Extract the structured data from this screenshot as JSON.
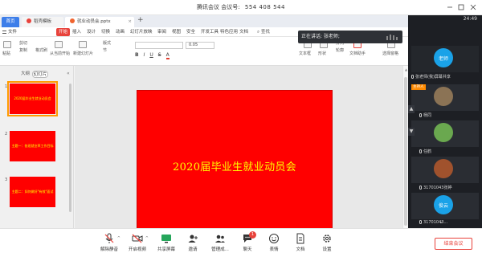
{
  "titlebar": {
    "app_name": "腾讯会议",
    "meeting_label": "会议号:",
    "meeting_id": "554 408 544"
  },
  "wps": {
    "tabs": {
      "home": "首页",
      "template": "稻壳模板",
      "document": "就业动员会.pptx"
    },
    "menu": {
      "file": "文件",
      "items": [
        "开始",
        "插入",
        "设计",
        "切换",
        "动画",
        "幻灯片放映",
        "审阅",
        "视图",
        "安全",
        "开发工具",
        "特色应用",
        "文档"
      ],
      "search": "查找"
    },
    "ribbon": {
      "cut": "剪切",
      "copy": "复制",
      "format_painter": "格式刷",
      "paste": "粘贴",
      "from_current": "从当前开始",
      "new_slide": "新建幻灯片",
      "layout": "版式",
      "section": "节",
      "font_name": "",
      "font_size": "0.05",
      "text_box": "文本框",
      "shape": "形状",
      "arrange": "排列",
      "outline": "轮廓",
      "doc_assist": "文档助手",
      "select_pane": "选择窗格"
    },
    "panel": {
      "outline_tab": "大纲",
      "slides_tab": "幻灯片",
      "collapse": "«"
    },
    "thumbnails": [
      {
        "num": "1",
        "text": "2020届毕业生就业动员会"
      },
      {
        "num": "2",
        "text": "主题一：各班就业率工作目标"
      },
      {
        "num": "3",
        "text": "主题二：如何做好\"有效\"面试"
      }
    ],
    "slide_title": "2020届毕业生就业动员会"
  },
  "toast": {
    "text": "正在讲话: 张老师;"
  },
  "sidebar": {
    "time": "24:49",
    "participants": [
      {
        "avatar": "老师",
        "name": "张老师(我)屏幕共享",
        "color": "#1aa2e8",
        "host": ""
      },
      {
        "avatar": "",
        "name": "杨同",
        "color": "#8b7355",
        "host": "主持人"
      },
      {
        "avatar": "",
        "name": "任鹤",
        "color": "#6aa84f",
        "host": ""
      },
      {
        "avatar": "",
        "name": "31701043张婷",
        "color": "#a0522d",
        "host": ""
      },
      {
        "avatar": "俊云",
        "name": "31701043...",
        "color": "#1aa2e8",
        "host": ""
      }
    ],
    "arrow_up": "▲",
    "arrow_dn": "▼",
    "down": "⌄"
  },
  "bottombar": {
    "mute": "解除静音",
    "video": "开启视频",
    "share": "共享屏幕",
    "invite": "邀请",
    "members": "管理成...",
    "chat": "聊天",
    "chat_badge": "1",
    "emoji": "表情",
    "docs": "文档",
    "settings": "设置",
    "end": "结束会议"
  },
  "colors": {
    "slide_bg": "#ff0000",
    "slide_text": "#ffff00",
    "accent": "#e8423b",
    "sidebar_bg": "#1d1f24"
  }
}
